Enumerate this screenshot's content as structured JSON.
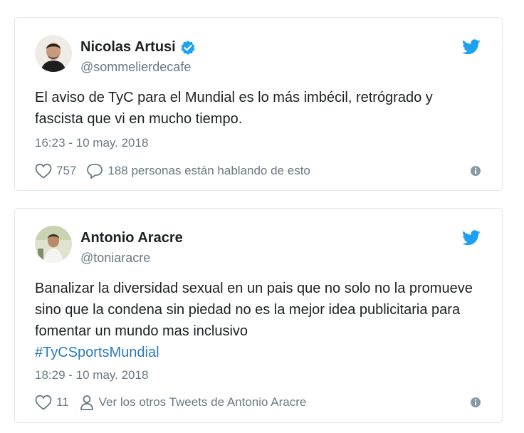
{
  "tweets": [
    {
      "name": "Nicolas Artusi",
      "verified": true,
      "handle": "@sommelierdecafe",
      "text": "El aviso de TyC para el Mundial es lo más imbécil, retrógrado y fascista que vi en mucho tiempo.",
      "timestamp": "16:23 - 10 may. 2018",
      "likes": "757",
      "replies_label": "188 personas están hablando de esto",
      "icons": [
        "avatar",
        "verified-badge-icon",
        "twitter-bird-icon",
        "heart-icon",
        "reply-icon",
        "info-icon"
      ]
    },
    {
      "name": "Antonio Aracre",
      "verified": false,
      "handle": "@toniaracre",
      "text": "Banalizar la diversidad sexual en un pais que no solo no la promueve sino que la condena sin piedad no es la mejor idea publicitaria para fomentar un mundo mas inclusivo",
      "hashtag": "#TyCSportsMundial",
      "timestamp": "18:29 - 10 may. 2018",
      "likes": "11",
      "more_label": "Ver los otros Tweets de Antonio Aracre",
      "icons": [
        "avatar",
        "twitter-bird-icon",
        "heart-icon",
        "person-icon",
        "info-icon"
      ]
    }
  ],
  "colors": {
    "text": "#1c2022",
    "secondary": "#697882",
    "link": "#2b7bb9",
    "twitter_blue": "#1da1f2",
    "border": "#e1e8ed"
  }
}
